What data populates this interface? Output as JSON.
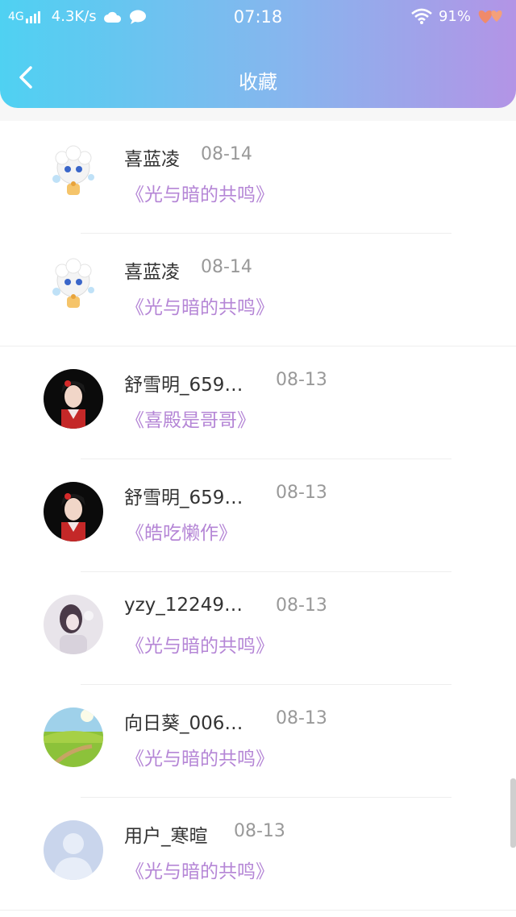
{
  "status_bar": {
    "network": "4G",
    "speed": "4.3K/s",
    "time": "07:18",
    "battery": "91%",
    "icons": [
      "signal-icon",
      "cloud-icon",
      "chat-bubble-icon",
      "wifi-icon",
      "heart-icon"
    ]
  },
  "header": {
    "title": "收藏",
    "back_icon": "chevron-left-icon",
    "gradient": [
      "#4fd1f2",
      "#b394e6"
    ]
  },
  "accent_color": "#b586d6",
  "items": [
    {
      "name": "喜蓝凌",
      "date": "08-14",
      "book": "《光与暗的共鸣》",
      "avatar": "cartoon-sheep"
    },
    {
      "name": "喜蓝凌",
      "date": "08-14",
      "book": "《光与暗的共鸣》",
      "avatar": "cartoon-sheep"
    },
    {
      "name": "舒雪明_659…",
      "date": "08-13",
      "book": "《喜殿是哥哥》",
      "avatar": "costume-girl"
    },
    {
      "name": "舒雪明_659…",
      "date": "08-13",
      "book": "《皓吃懒作》",
      "avatar": "costume-girl"
    },
    {
      "name": "yzy_12249…",
      "date": "08-13",
      "book": "《光与暗的共鸣》",
      "avatar": "girl-photo"
    },
    {
      "name": "向日葵_006…",
      "date": "08-13",
      "book": "《光与暗的共鸣》",
      "avatar": "green-field"
    },
    {
      "name": "用户_寒暄",
      "date": "08-13",
      "book": "《光与暗的共鸣》",
      "avatar": "default-user"
    }
  ]
}
